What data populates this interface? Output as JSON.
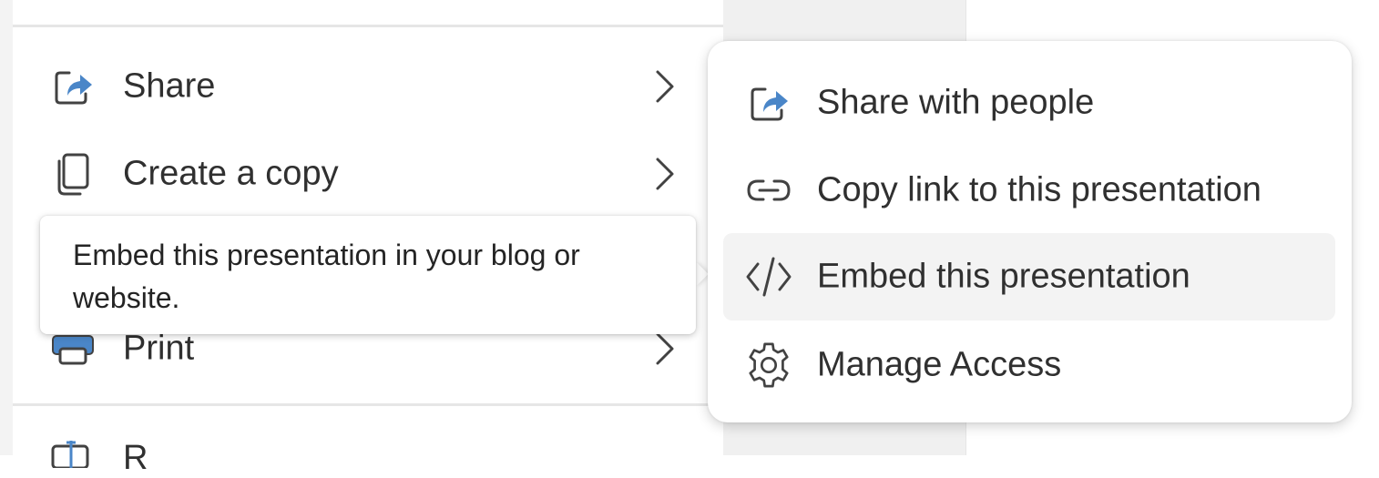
{
  "file_menu": {
    "items": [
      {
        "label": "Share",
        "icon": "share-icon"
      },
      {
        "label": "Create a copy",
        "icon": "copy-icon"
      },
      {
        "label": "Print",
        "icon": "print-icon"
      }
    ],
    "partial_item": {
      "label": "R",
      "icon": "rename-icon"
    }
  },
  "tooltip": {
    "text": "Embed this presentation in your blog or website."
  },
  "share_submenu": {
    "items": [
      {
        "label": "Share with people",
        "icon": "share-icon"
      },
      {
        "label": "Copy link to this presentation",
        "icon": "link-icon"
      },
      {
        "label": "Embed this presentation",
        "icon": "code-icon",
        "hovered": true
      },
      {
        "label": "Manage Access",
        "icon": "gear-icon"
      }
    ]
  },
  "colors": {
    "accent": "#4a86c8",
    "icon_stroke": "#424242",
    "hover_background": "#f3f3f3"
  }
}
